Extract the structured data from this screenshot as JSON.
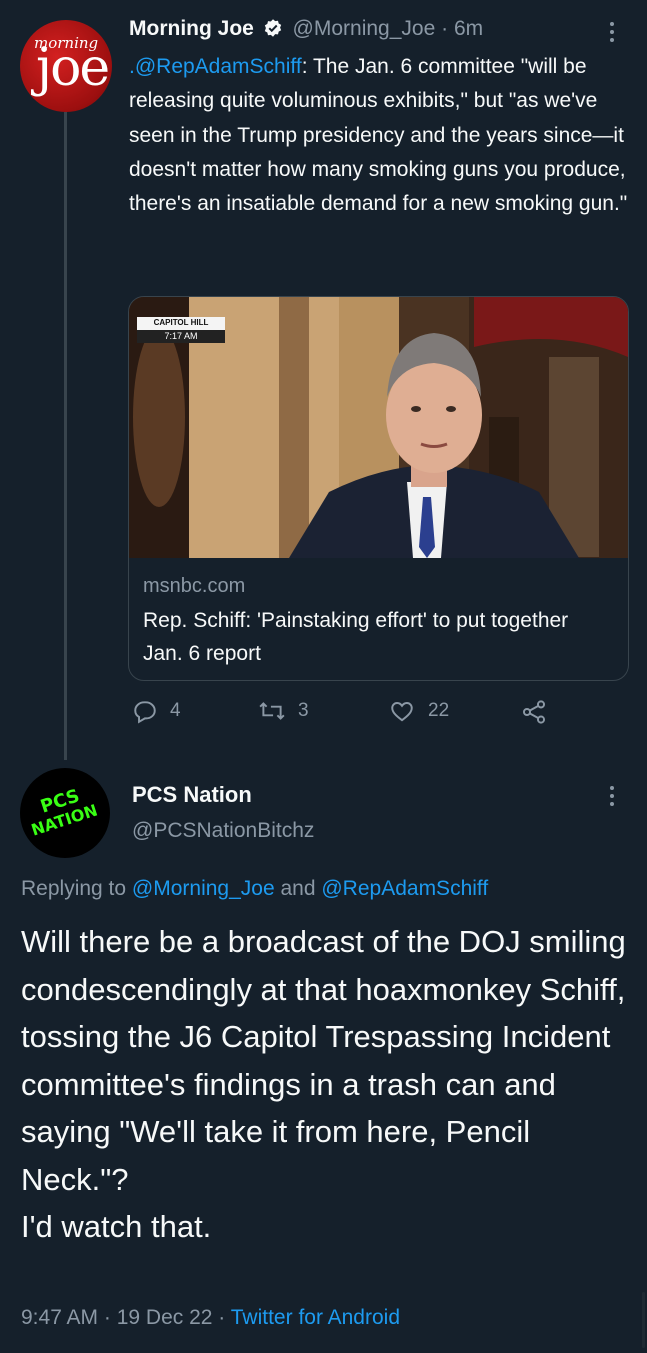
{
  "tweet1": {
    "avatar_text_small": "morning",
    "avatar_text_big": "joe",
    "name": "Morning Joe",
    "handle": "@Morning_Joe",
    "time": "6m",
    "separator": " · ",
    "mention": ".@RepAdamSchiff",
    "text_rest": ": The Jan. 6 committee \"will be releasing quite voluminous exhibits,\" but \"as we've seen in the Trump presidency and the years since—it doesn't matter how many smoking guns you produce, there's an insatiable demand for a new smoking gun.\"",
    "card": {
      "chyron_line1": "CAPITOL HILL",
      "chyron_line2": "7:17 AM",
      "domain": "msnbc.com",
      "title": "Rep. Schiff: 'Painstaking effort' to put together Jan. 6 report"
    },
    "actions": {
      "replies": "4",
      "retweets": "3",
      "likes": "22"
    }
  },
  "tweet2": {
    "avatar_line1": "PCS",
    "avatar_line2": "NATION",
    "name": "PCS Nation",
    "handle": "@PCSNationBitchz",
    "replying_prefix": "Replying to ",
    "replying_user1": "@Morning_Joe",
    "replying_and": " and ",
    "replying_user2": "@RepAdamSchiff",
    "text_main": "Will there be a broadcast of the DOJ smiling condescendingly at that hoaxmonkey Schiff, tossing the J6 Capitol Trespassing Incident committee's findings in a trash can and saying \"We'll take it from here, Pencil Neck.\"?",
    "text_last": "I'd watch that.",
    "time": "9:47 AM",
    "date": "19 Dec 22",
    "source": "Twitter for Android",
    "dot": " · "
  },
  "colors": {
    "background": "#15202b",
    "accent": "#1d9bf0",
    "secondary": "#8b98a5",
    "text": "#f7f9f9"
  }
}
